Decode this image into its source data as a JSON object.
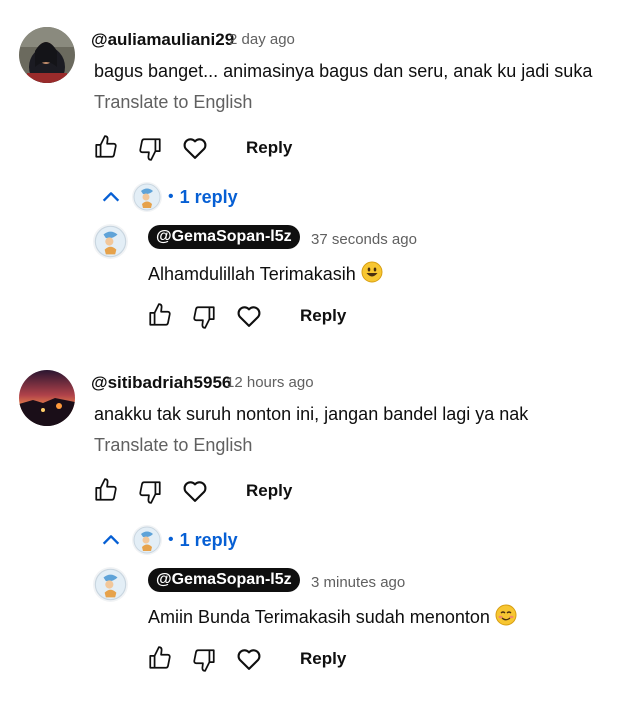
{
  "comments": [
    {
      "author": "@auliamauliani29",
      "time": "2 day ago",
      "text": "bagus banget... animasinya bagus dan seru, anak ku jadi suka",
      "translate_label": "Translate to English",
      "reply_label": "Reply",
      "replies_toggle": {
        "dot": "•",
        "count_label": "1 reply"
      },
      "reply": {
        "author_badge": "@GemaSopan-l5z",
        "time": "37 seconds ago",
        "text": "Alhamdulillah Terimakasih",
        "emoji": "grinning-face-emoji",
        "reply_label": "Reply"
      }
    },
    {
      "author": "@sitibadriah5956",
      "time": "12 hours ago",
      "text": "anakku tak suruh nonton ini, jangan bandel lagi ya nak",
      "translate_label": "Translate to English",
      "reply_label": "Reply",
      "replies_toggle": {
        "dot": "•",
        "count_label": "1 reply"
      },
      "reply": {
        "author_badge": "@GemaSopan-l5z",
        "time": "3 minutes ago",
        "text": "Amiin Bunda Terimakasih sudah menonton",
        "emoji": "smiling-face-emoji",
        "reply_label": "Reply"
      }
    }
  ],
  "colors": {
    "link": "#065fd4",
    "secondary": "#606060",
    "badge_bg": "#0f0f0f"
  }
}
